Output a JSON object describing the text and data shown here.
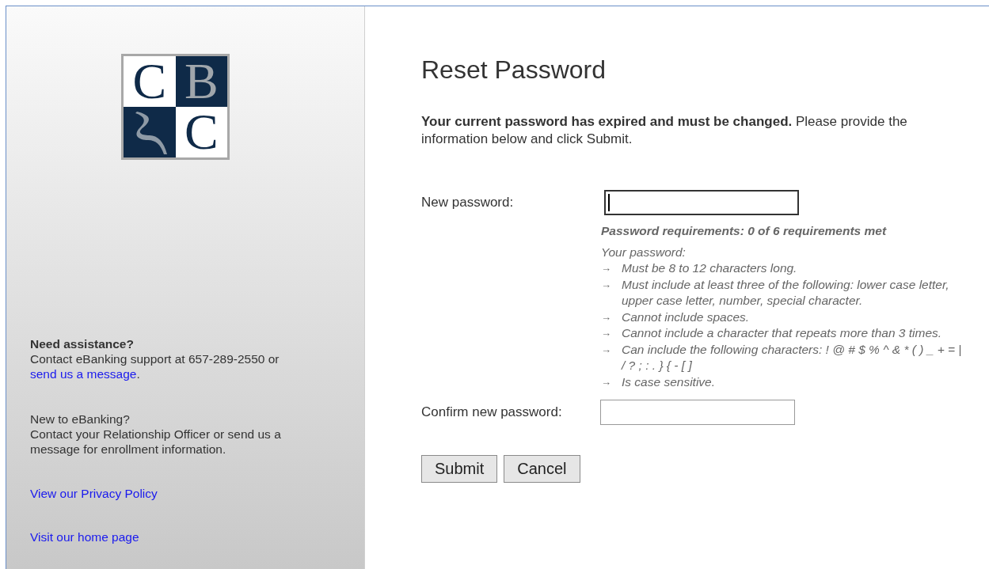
{
  "logo": {
    "cells": [
      {
        "kind": "letter",
        "text": "C",
        "dark": false
      },
      {
        "kind": "letter",
        "text": "B",
        "dark": true
      },
      {
        "kind": "swoosh",
        "dark": true
      },
      {
        "kind": "letter",
        "text": "C",
        "dark": false
      }
    ]
  },
  "sidebar": {
    "blocks": [
      {
        "title": "Need assistance?",
        "bold": true,
        "text": "Contact eBanking support at 657-289-2550 or ",
        "link": "send us a message",
        "after": "."
      },
      {
        "title": "New to eBanking?",
        "bold": false,
        "text": "Contact your Relationship Officer or send us a message for enrollment information."
      }
    ],
    "links": [
      "View our Privacy Policy",
      "Visit our home page"
    ]
  },
  "main": {
    "title": "Reset Password",
    "intro": "**Your current password has expired and must be changed.** Please provide the information below and click Submit.",
    "new_password": {
      "label": "New password:",
      "focused": true
    },
    "requirements": {
      "heading": "Password requirements: 0 of 6 requirements met",
      "lead": "Your password:",
      "bullet": "→",
      "items": [
        "Must be 8 to 12 characters long.",
        "Must include at least three of the following: lower case letter, upper case letter, number, special character.",
        "Cannot include spaces.",
        "Cannot include a character that repeats more than 3 times.",
        "Can include the following characters: ! @ # $ % ^ & * ( ) _ + = | / ? ; : . } { - [ ]",
        "Is case sensitive."
      ]
    },
    "confirm_password": {
      "label": "Confirm new password:",
      "focused": false
    },
    "buttons": [
      "Submit",
      "Cancel"
    ]
  }
}
